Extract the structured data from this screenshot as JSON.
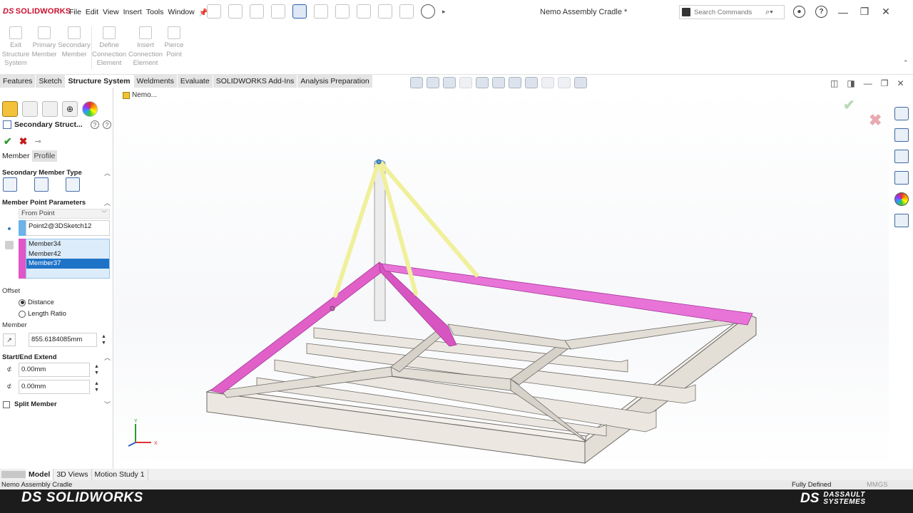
{
  "app": {
    "logo_prefix": "DS",
    "logo_text": "SOLIDWORKS",
    "document_title": "Nemo Assembly Cradle *"
  },
  "menu": [
    "File",
    "Edit",
    "View",
    "Insert",
    "Tools",
    "Window"
  ],
  "search": {
    "placeholder": "Search Commands"
  },
  "ribbon": [
    {
      "label": "Exit\nStructure\nSystem"
    },
    {
      "label": "Primary\nMember"
    },
    {
      "label": "Secondary\nMember"
    },
    {
      "label": "Define\nConnection\nElement"
    },
    {
      "label": "Insert\nConnection\nElement"
    },
    {
      "label": "Pierce\nPoint"
    }
  ],
  "tabs": [
    "Features",
    "Sketch",
    "Structure System",
    "Weldments",
    "Evaluate",
    "SOLIDWORKS Add-Ins",
    "Analysis Preparation"
  ],
  "active_tab": "Structure System",
  "tree_flyout": "Nemo...",
  "property_manager": {
    "title": "Secondary Struct...",
    "subtabs": [
      "Member",
      "Profile"
    ],
    "secondary_member_type": "Secondary Member Type",
    "member_point_parameters": "Member Point Parameters",
    "point_mode": "From Point",
    "point_selection": "Point2@3DSketch12",
    "members": [
      "Member34",
      "Member42",
      "Member37"
    ],
    "selected_member": "Member37",
    "offset_label": "Offset",
    "offset_options": [
      "Distance",
      "Length Ratio"
    ],
    "offset_selected": "Distance",
    "member_label": "Member",
    "member_distance": "855.6184085mm",
    "start_end_extend": "Start/End Extend",
    "start_extend": "0.00mm",
    "end_extend": "0.00mm",
    "split_member": "Split Member"
  },
  "triad": {
    "x": "X",
    "y": "Y"
  },
  "bottom_tabs": [
    "Model",
    "3D Views",
    "Motion Study 1"
  ],
  "status": {
    "left": "Nemo Assembly Cradle",
    "right": "Fully Defined",
    "units": "MMGS"
  },
  "footer": {
    "left_brand": "SOLIDWORKS",
    "right_brand_line1": "DASSAULT",
    "right_brand_line2": "SYSTEMES"
  },
  "colors": {
    "highlight_member": "#e055c8",
    "secondary_member": "#f2f2a0",
    "frame": "#e9e5dd",
    "selection_blue": "#1f73c7",
    "accent_red": "#c8102e"
  }
}
